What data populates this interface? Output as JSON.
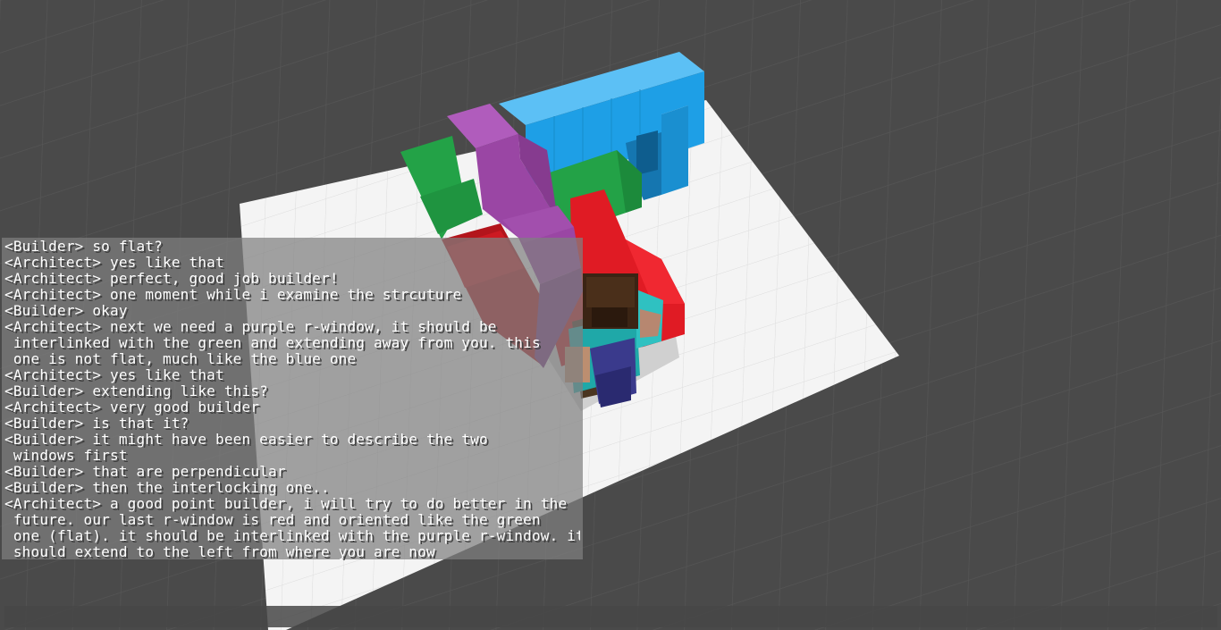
{
  "scene": {
    "ground_color": "#4a4a4a",
    "platform_color": "#f4f4f4",
    "block_colors": {
      "blue": "#1e9fe6",
      "purple": "#9a46a4",
      "green": "#23a247",
      "red": "#e01b24"
    },
    "player_icon": "steve-player-icon"
  },
  "chat": {
    "lines": [
      "<Builder> so flat?",
      "<Architect> yes like that",
      "<Architect> perfect, good job builder!",
      "<Architect> one moment while i examine the strcuture",
      "<Builder> okay",
      "<Architect> next we need a purple r-window, it should be",
      " interlinked with the green and extending away from you. this",
      " one is not flat, much like the blue one",
      "<Architect> yes like that",
      "<Builder> extending like this?",
      "<Architect> very good builder",
      "<Builder> is that it?",
      "<Builder> it might have been easier to describe the two",
      " windows first",
      "<Builder> that are perpendicular",
      "<Builder> then the interlocking one..",
      "<Architect> a good point builder, i will try to do better in the",
      " future. our last r-window is red and oriented like the green",
      " one (flat). it should be interlinked with the purple r-window. it",
      " should extend to the left from where you are now"
    ],
    "input_value": ""
  }
}
